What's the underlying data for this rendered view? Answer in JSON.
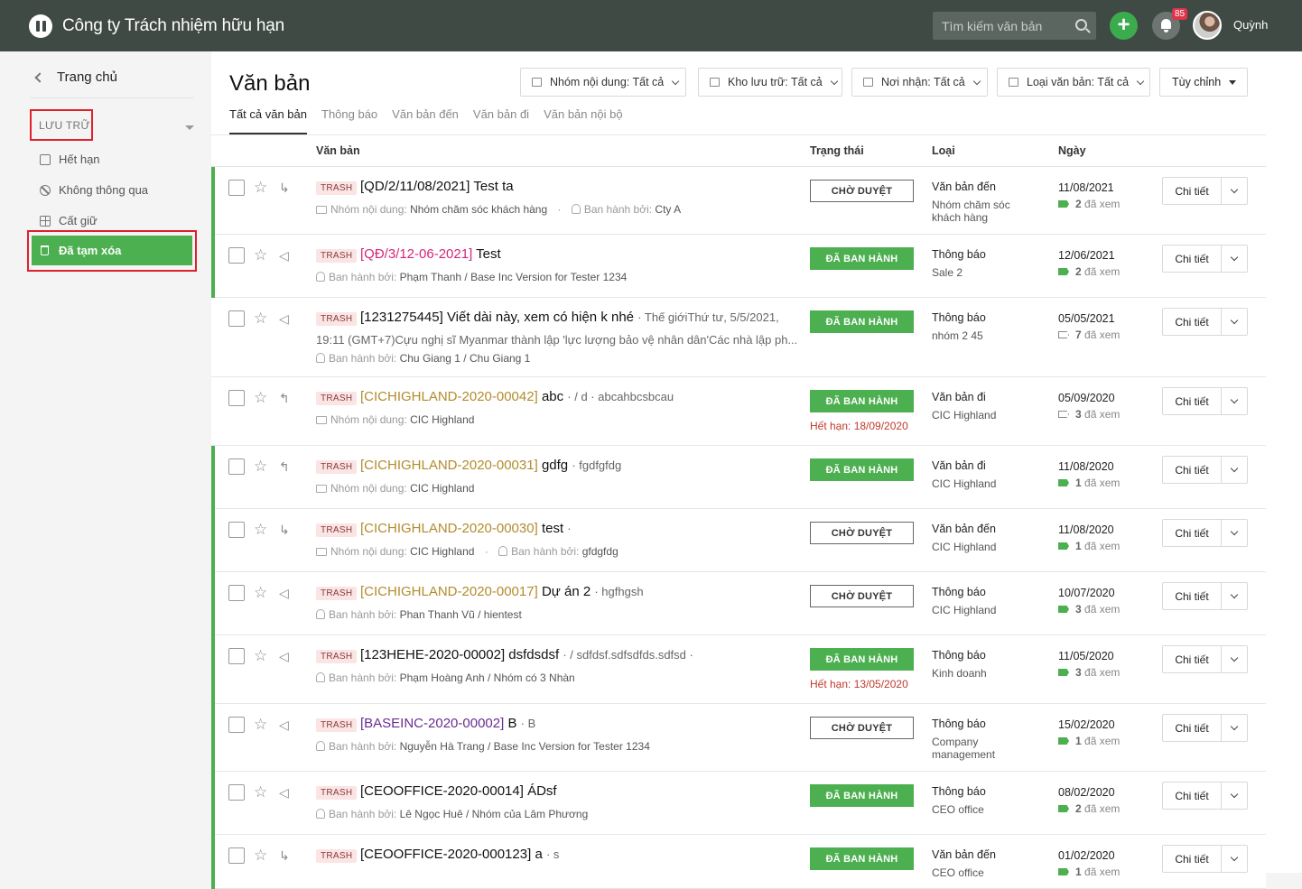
{
  "app": {
    "company": "Công ty Trách nhiệm hữu hạn",
    "user": "Quỳnh",
    "notifications": "85"
  },
  "search": {
    "placeholder": "Tìm kiếm văn bản"
  },
  "sidebar": {
    "home": "Trang chủ",
    "section": "LƯU TRỮ",
    "items": [
      {
        "label": "Hết hạn",
        "icon": "doc-expired-icon"
      },
      {
        "label": "Không thông qua",
        "icon": "block-icon"
      },
      {
        "label": "Cất giữ",
        "icon": "archive-icon"
      },
      {
        "label": "Đã tạm xóa",
        "icon": "trash-icon",
        "active": true
      }
    ]
  },
  "main": {
    "title": "Văn bản",
    "filters": [
      "Nhóm nội dung: Tất cả",
      "Kho lưu trữ: Tất cả",
      "Nơi nhận: Tất cả",
      "Loại văn bản: Tất cả"
    ],
    "custom": "Tùy chỉnh",
    "tabs": [
      "Tất cả văn bản",
      "Thông báo",
      "Văn bản đến",
      "Văn bản đi",
      "Văn bản nội bộ"
    ],
    "columns": {
      "doc": "Văn bản",
      "status": "Trạng thái",
      "type": "Loại",
      "date": "Ngày"
    }
  },
  "labels": {
    "trash": "TRASH",
    "detail": "Chi tiết",
    "seen": "đã xem"
  },
  "rows": [
    {
      "code": "[QD/2/11/08/2021]",
      "name": "Test ta",
      "extra": "",
      "meta1": "Nhóm nội dung:",
      "meta1v": "Nhóm chăm sóc khách hàng",
      "meta2": "Ban hành bởi:",
      "meta2v": "Cty A",
      "status": "CHỜ DUYỆT",
      "type": "Văn bản đến",
      "sub": "Nhóm chăm sóc khách hàng",
      "date": "11/08/2021",
      "seen": "2"
    },
    {
      "code": "[QĐ/3/12-06-2021]",
      "name": "Test",
      "extra": "",
      "meta2": "Ban hành bởi:",
      "meta2v": "Phạm Thanh / Base Inc Version for Tester 1234",
      "status": "ĐÃ BAN HÀNH",
      "type": "Thông báo",
      "sub": "Sale 2",
      "date": "12/06/2021",
      "seen": "2"
    },
    {
      "code": "[1231275445]",
      "name": "Viết dài này, xem có hiện k nhé",
      "extra": "· Thế giớiThứ tư, 5/5/2021,",
      "line2": "19:11 (GMT+7)Cựu nghị sĩ Myanmar thành lập 'lực lượng bảo vệ nhân dân'Các nhà lập ph...",
      "meta2": "Ban hành bởi:",
      "meta2v": "Chu Giang 1 / Chu Giang 1",
      "status": "ĐÃ BAN HÀNH",
      "type": "Thông báo",
      "sub": "nhóm 2 45",
      "date": "05/05/2021",
      "seen": "7"
    },
    {
      "code": "[CICHIGHLAND-2020-00042]",
      "name": "abc",
      "extra": "· / d · abcahbcsbcau",
      "meta1": "Nhóm nội dung:",
      "meta1v": "CIC Highland",
      "status": "ĐÃ BAN HÀNH",
      "expire": "Hết hạn: 18/09/2020",
      "type": "Văn bản đi",
      "sub": "CIC Highland",
      "date": "05/09/2020",
      "seen": "3"
    },
    {
      "code": "[CICHIGHLAND-2020-00031]",
      "name": "gdfg",
      "extra": "· fgdfgfdg",
      "meta1": "Nhóm nội dung:",
      "meta1v": "CIC Highland",
      "status": "ĐÃ BAN HÀNH",
      "type": "Văn bản đi",
      "sub": "CIC Highland",
      "date": "11/08/2020",
      "seen": "1"
    },
    {
      "code": "[CICHIGHLAND-2020-00030]",
      "name": "test",
      "extra": "·",
      "meta1": "Nhóm nội dung:",
      "meta1v": "CIC Highland",
      "meta2": "Ban hành bởi:",
      "meta2v": "gfdgfdg",
      "status": "CHỜ DUYỆT",
      "type": "Văn bản đến",
      "sub": "CIC Highland",
      "date": "11/08/2020",
      "seen": "1"
    },
    {
      "code": "[CICHIGHLAND-2020-00017]",
      "name": "Dự án 2",
      "extra": "· hgfhgsh",
      "meta2": "Ban hành bởi:",
      "meta2v": "Phan Thanh Vũ / hientest",
      "status": "CHỜ DUYỆT",
      "type": "Thông báo",
      "sub": "CIC Highland",
      "date": "10/07/2020",
      "seen": "3"
    },
    {
      "code": "[123HEHE-2020-00002]",
      "name": "dsfdsdsf",
      "extra": "· / sdfdsf.sdfsdfds.sdfsd ·",
      "meta2": "Ban hành bởi:",
      "meta2v": "Phạm Hoàng Anh / Nhóm có 3 Nhàn",
      "status": "ĐÃ BAN HÀNH",
      "expire": "Hết hạn: 13/05/2020",
      "type": "Thông báo",
      "sub": "Kinh doanh",
      "date": "11/05/2020",
      "seen": "3"
    },
    {
      "code": "[BASEINC-2020-00002]",
      "name": "B",
      "extra": "· B",
      "meta2": "Ban hành bởi:",
      "meta2v": "Nguyễn Hà Trang / Base Inc Version for Tester 1234",
      "status": "CHỜ DUYỆT",
      "type": "Thông báo",
      "sub": "Company management",
      "date": "15/02/2020",
      "seen": "1"
    },
    {
      "code": "[CEOOFFICE-2020-00014]",
      "name": "ÁDsf",
      "extra": "",
      "meta2": "Ban hành bởi:",
      "meta2v": "Lê Ngọc Huê / Nhóm của Lâm Phương",
      "status": "ĐÃ BAN HÀNH",
      "type": "Thông báo",
      "sub": "CEO office",
      "date": "08/02/2020",
      "seen": "2"
    },
    {
      "code": "[CEOOFFICE-2020-000123]",
      "name": "a",
      "extra": "· s",
      "status": "ĐÃ BAN HÀNH",
      "type": "Văn bản đến",
      "sub": "CEO office",
      "date": "01/02/2020",
      "seen": "1"
    }
  ]
}
